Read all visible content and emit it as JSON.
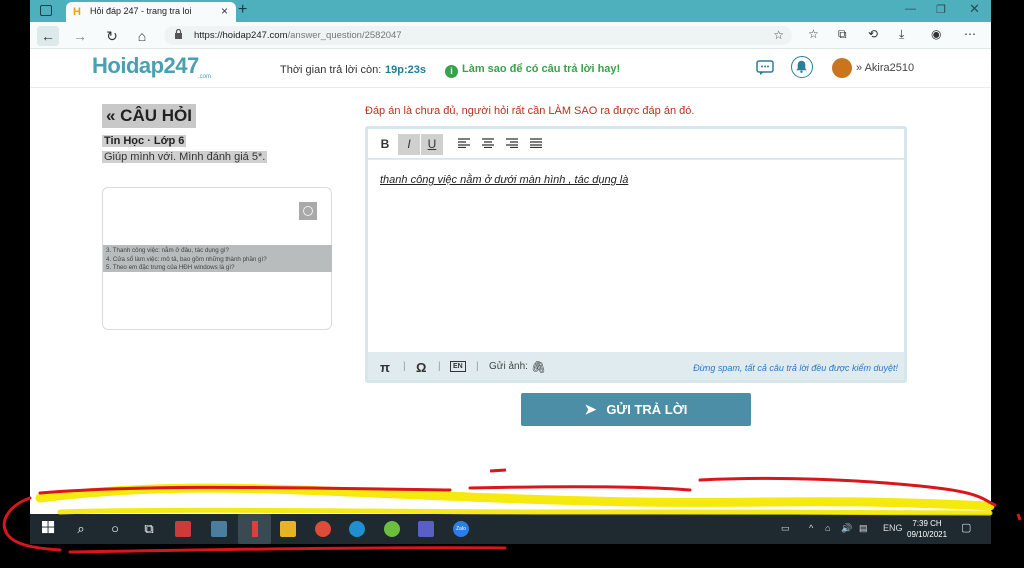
{
  "browser": {
    "tab_title": "Hỏi đáp 247 - trang tra loi",
    "url_host": "https://hoidap247.com",
    "url_path": "/answer_question/2582047"
  },
  "header": {
    "logo": "Hoidap247",
    "logo_sub": ".com",
    "timer_label": "Thời gian trả lời còn:",
    "timer_value": "19p:23s",
    "tip": "Làm sao để có câu trả lời hay!",
    "username": "Akira2510"
  },
  "question": {
    "heading": "« CÂU HỎI",
    "subject": "Tin Học · Lớp 6",
    "text": "Giúp mình với. Mình đánh giá 5*.",
    "image_lines": [
      "3. Thanh công việc: nằm ở đâu, tác dụng gì?",
      "4. Cửa sổ làm việc: mô tả, bao gồm những thành phần gì?",
      "5. Theo em đặc trưng của HĐH windows là gì?"
    ]
  },
  "editor": {
    "warning": "Đáp án là chưa đủ, người hỏi rất cần LÀM SAO ra được đáp án đó.",
    "toolbar": {
      "bold": "B",
      "italic": "I",
      "underline": "U"
    },
    "content": "thanh công việc nằm ở dưới màn hình , tác dụng là",
    "footer": {
      "pi": "π",
      "omega": "Ω",
      "lang": "EN",
      "attach_label": "Gửi ảnh:",
      "spam_note": "Đừng spam, tất cả câu trả lời đều được kiểm duyệt!"
    },
    "submit": "GỬI TRẢ LỜI"
  },
  "taskbar": {
    "lang": "ENG",
    "time": "7:39 CH",
    "date": "09/10/2021",
    "zalo": "Zalo"
  },
  "colors": {
    "accent": "#4b8ea6",
    "brand_orange": "#e6a500",
    "tip_green": "#3aa14a",
    "warning_red": "#b5311f",
    "scribble_red": "#d8161b",
    "scribble_yellow": "#f4e800"
  }
}
